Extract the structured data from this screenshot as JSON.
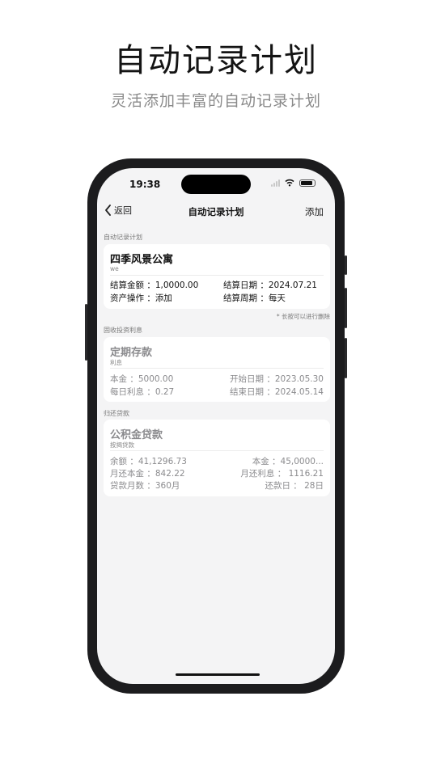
{
  "promo": {
    "title": "自动记录计划",
    "subtitle": "灵活添加丰富的自动记录计划"
  },
  "status_bar": {
    "time": "19:38"
  },
  "nav": {
    "back_label": "返回",
    "title": "自动记录计划",
    "add_label": "添加"
  },
  "sections": [
    {
      "label": "自动记录计划",
      "card": {
        "title": "四季风景公寓",
        "subtitle": "we",
        "rows": [
          {
            "left": "结算金额 ：1,0000.00",
            "right": "结算日期 ：2024.07.21"
          },
          {
            "left": "资产操作 ：添加",
            "right": "结算周期 ：每天"
          }
        ]
      },
      "hint": "* 长按可以进行删除"
    },
    {
      "label": "固收投资利息",
      "card": {
        "title": "定期存款",
        "subtitle": "利息",
        "rows": [
          {
            "left": "本金 ：5000.00",
            "right": "开始日期 ：2023.05.30"
          },
          {
            "left": "每日利息 ：0.27",
            "right": "结束日期 ：2024.05.14"
          }
        ]
      }
    },
    {
      "label": "归还贷款",
      "card": {
        "title": "公积金贷款",
        "subtitle": "按揭贷款",
        "rows": [
          {
            "left": "余额 ：41,1296.73",
            "right": "本金 ：45,0000..."
          },
          {
            "left": "月还本金 ：842.22",
            "right": "月还利息 ：  1116.21"
          },
          {
            "left": "贷款月数 ：360月",
            "right": "还款日 ：   28日"
          }
        ]
      }
    }
  ]
}
